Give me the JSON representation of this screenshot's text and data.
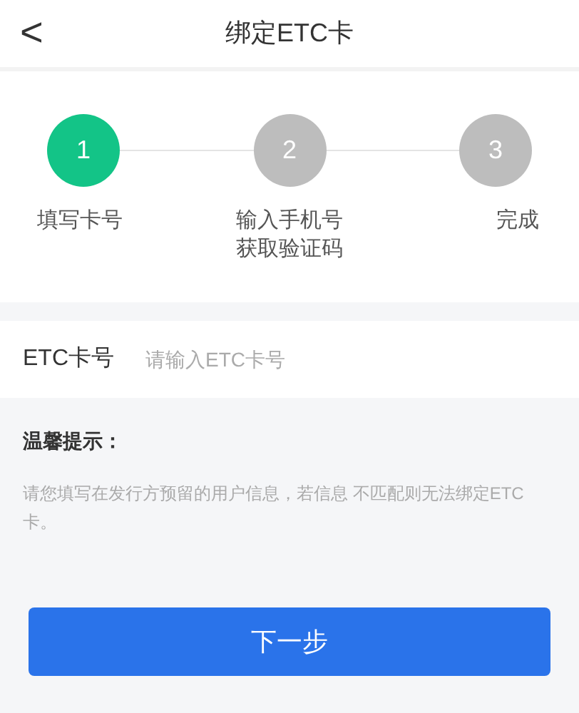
{
  "header": {
    "back": "<",
    "title": "绑定ETC卡"
  },
  "steps": [
    {
      "number": "1",
      "label": "填写卡号",
      "active": true
    },
    {
      "number": "2",
      "label": "输入手机号获取验证码",
      "active": false
    },
    {
      "number": "3",
      "label": "完成",
      "active": false
    }
  ],
  "card_field": {
    "label": "ETC卡号",
    "placeholder": "请输入ETC卡号"
  },
  "tip": {
    "title": "温馨提示：",
    "text": "请您填写在发行方预留的用户信息，若信息 不匹配则无法绑定ETC卡。"
  },
  "next_button": "下一步"
}
